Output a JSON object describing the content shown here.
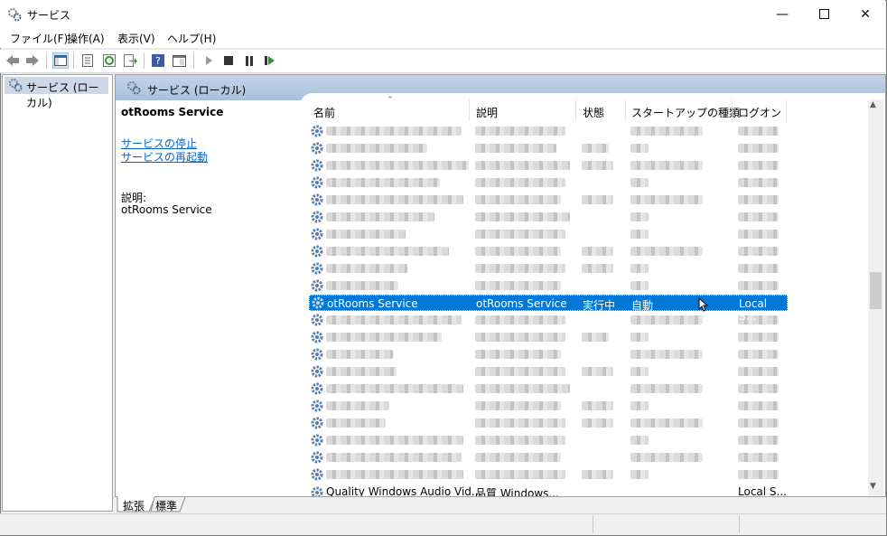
{
  "window": {
    "title": "サービス",
    "icon": "gears-icon"
  },
  "menu": [
    "ファイル(F)",
    "操作(A)",
    "表示(V)",
    "ヘルプ(H)"
  ],
  "toolbar": {
    "icons": [
      "back-arrow-icon",
      "forward-arrow-icon",
      "console-tree-icon",
      "properties-icon",
      "refresh-icon",
      "export-icon",
      "help-icon",
      "show-pane-icon",
      "start-service-icon",
      "stop-service-icon",
      "pause-service-icon",
      "resume-service-icon"
    ]
  },
  "tree": {
    "item": "サービス (ローカル)"
  },
  "pane": {
    "header": "サービス (ローカル)",
    "selected_service": "otRooms Service",
    "actions": [
      "サービスの停止",
      "サービスの再起動"
    ],
    "description_label": "説明:",
    "description_value": "otRooms Service"
  },
  "columns": [
    "名前",
    "説明",
    "状態",
    "スタートアップの種類",
    "ログオン"
  ],
  "selected_row": {
    "name": "otRooms Service",
    "description": "otRooms Service",
    "status": "実行中",
    "startup": "自動",
    "logon": "Local S..."
  },
  "last_row": {
    "name": "Quality Windows Audio Vid...",
    "description": "品質 Windows...",
    "logon": "Local S..."
  },
  "tabs": [
    "拡張",
    "標準"
  ],
  "colors": {
    "selection": "#0078d7",
    "link": "#0066cc",
    "header": "#b5c9e1"
  }
}
